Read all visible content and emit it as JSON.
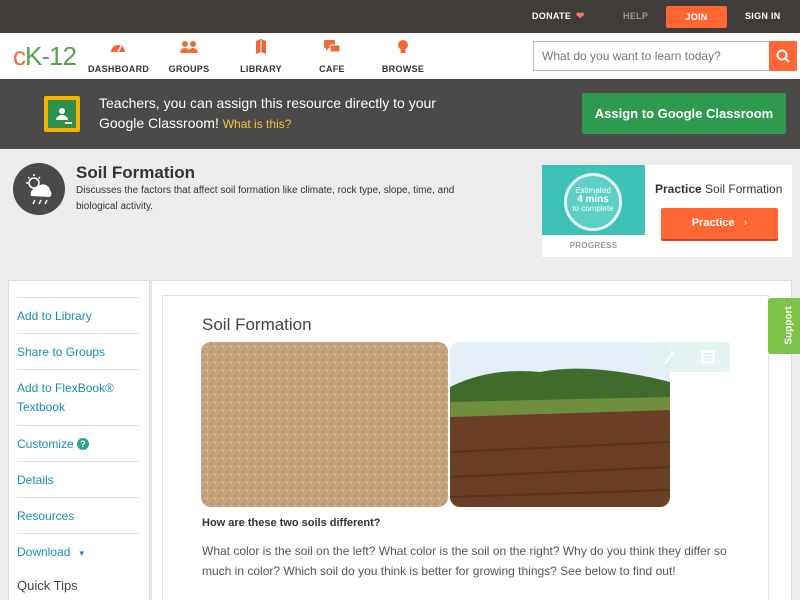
{
  "topbar": {
    "donate": "DONATE",
    "help": "HELP",
    "join": "JOIN",
    "signin": "SIGN IN"
  },
  "logo": {
    "c": "c",
    "k": "K",
    "dash": "-",
    "num": "12"
  },
  "nav": {
    "dashboard": "DASHBOARD",
    "groups": "GROUPS",
    "library": "LIBRARY",
    "cafe": "CAFE",
    "browse": "BROWSE"
  },
  "search": {
    "placeholder": "What do you want to learn today?"
  },
  "classroom": {
    "text": "Teachers, you can assign this resource directly to your Google Classroom!",
    "link": "What is this?",
    "button": "Assign to Google Classroom"
  },
  "resource": {
    "title": "Soil Formation",
    "description": "Discusses the factors that affect soil formation like climate, rock type, slope, time, and biological activity."
  },
  "practice": {
    "estimated": "Estimated",
    "mins": "4 mins",
    "complete": "to complete",
    "progress": "PROGRESS",
    "title_bold": "Practice",
    "title_rest": "Soil Formation",
    "button": "Practice"
  },
  "sidebar": {
    "items": [
      {
        "label": "Add to Library"
      },
      {
        "label": "Share to Groups"
      },
      {
        "label": "Add to FlexBook® Textbook"
      },
      {
        "label": "Customize"
      },
      {
        "label": "Details"
      },
      {
        "label": "Resources"
      },
      {
        "label": "Download"
      }
    ],
    "quick_tips": "Quick Tips"
  },
  "content": {
    "title": "Soil Formation",
    "question": "How are these two soils different?",
    "body": "What color is the soil on the left? What color is the soil on the right? Why do you think they differ so much in color? Which soil do you think is better for growing things? See below to find out!"
  },
  "support": {
    "label": "Support"
  },
  "colors": {
    "accent": "#ff6633",
    "link": "#1a8cb2",
    "classroom_green": "#2d9a4e",
    "support_green": "#7ec24a"
  }
}
